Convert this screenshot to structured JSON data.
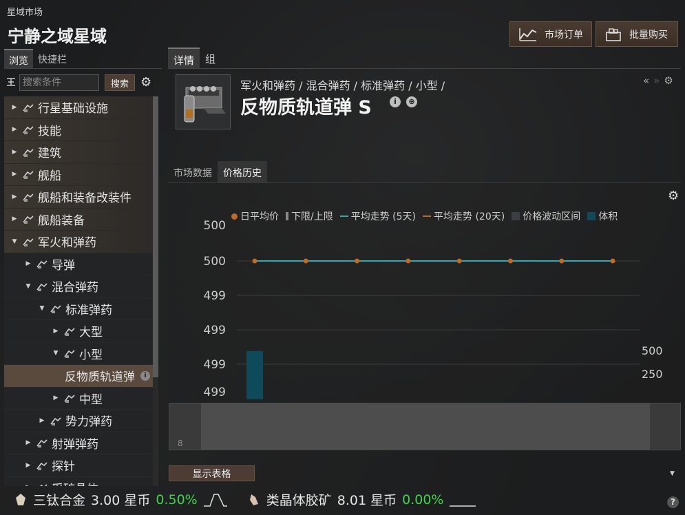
{
  "window": {
    "title": "星域市场",
    "region": "宁静之域星域",
    "buttons": {
      "orders": "市场订单",
      "bulk_buy": "批量购买"
    }
  },
  "left": {
    "tabs": [
      "浏览",
      "快捷栏"
    ],
    "active_tab": "浏览",
    "search": {
      "placeholder": "搜索条件",
      "button": "搜索"
    },
    "tree": [
      {
        "label": "行星基础设施",
        "level": 0,
        "expanded": false,
        "icon": "planet-icon"
      },
      {
        "label": "技能",
        "level": 0,
        "expanded": false,
        "icon": "book-icon"
      },
      {
        "label": "建筑",
        "level": 0,
        "expanded": false,
        "icon": "structure-icon"
      },
      {
        "label": "舰船",
        "level": 0,
        "expanded": false,
        "icon": "ship-icon"
      },
      {
        "label": "舰船和装备改装件",
        "level": 0,
        "expanded": false,
        "icon": "rig-icon"
      },
      {
        "label": "舰船装备",
        "level": 0,
        "expanded": false,
        "icon": "module-icon"
      },
      {
        "label": "军火和弹药",
        "level": 0,
        "expanded": true,
        "icon": "ammo-icon"
      },
      {
        "label": "导弹",
        "level": 1,
        "expanded": false,
        "icon": "missile-icon"
      },
      {
        "label": "混合弹药",
        "level": 1,
        "expanded": true,
        "icon": "hybrid-icon"
      },
      {
        "label": "标准弹药",
        "level": 2,
        "expanded": true,
        "icon": "hybrid-icon"
      },
      {
        "label": "大型",
        "level": 3,
        "expanded": false,
        "icon": "hybrid-icon"
      },
      {
        "label": "小型",
        "level": 3,
        "expanded": true,
        "icon": "hybrid-icon"
      },
      {
        "label": "反物质轨道弹",
        "level": 4,
        "leaf": true,
        "selected": true
      },
      {
        "label": "中型",
        "level": 3,
        "expanded": false,
        "icon": "hybrid-icon"
      },
      {
        "label": "势力弹药",
        "level": 2,
        "expanded": false,
        "icon": "faction-icon"
      },
      {
        "label": "射弹弹药",
        "level": 1,
        "expanded": false,
        "icon": "projectile-icon"
      },
      {
        "label": "探针",
        "level": 1,
        "expanded": false,
        "icon": "probe-icon"
      },
      {
        "label": "采矿晶体",
        "level": 1,
        "expanded": false,
        "icon": "crystal-icon"
      }
    ]
  },
  "right": {
    "tabs": [
      "详情",
      "组"
    ],
    "active_tab": "详情",
    "breadcrumb": "军火和弹药 / 混合弹药 / 标准弹药 / 小型 /",
    "item_name": "反物质轨道弹 S",
    "sub_tabs": [
      "市场数据",
      "价格历史"
    ],
    "active_sub_tab": "价格历史",
    "show_table": "显示表格",
    "slider_label": "8"
  },
  "chart_data": {
    "type": "line",
    "legend": [
      {
        "name": "日平均价",
        "kind": "dot",
        "color": "#c06a22"
      },
      {
        "name": "下限/上限",
        "kind": "bar",
        "color": "#888888"
      },
      {
        "name": "平均走势 (5天)",
        "kind": "line",
        "color": "#3aa6b0"
      },
      {
        "name": "平均走势 (20天)",
        "kind": "line",
        "color": "#c06a22"
      },
      {
        "name": "价格波动区间",
        "kind": "square",
        "color": "#3a3f44"
      },
      {
        "name": "体积",
        "kind": "square",
        "color": "#0f4a5a"
      }
    ],
    "y_tick_labels": [
      "500",
      "500",
      "499",
      "499",
      "499",
      "499"
    ],
    "volume_tick_labels": [
      "500",
      "250"
    ],
    "series": [
      {
        "name": "日平均价",
        "values": [
          500,
          500,
          500,
          500,
          500,
          500,
          500,
          500
        ]
      },
      {
        "name": "平均走势 (5天)",
        "values": [
          500,
          500,
          500,
          500,
          500,
          500,
          500,
          500
        ]
      }
    ],
    "volume": [
      620,
      0,
      0,
      0,
      0,
      0,
      0,
      0
    ],
    "volume_max": 750
  },
  "ticker": [
    {
      "name": "三钛合金",
      "price": "3.00 星币",
      "change": "0.50%",
      "icon": "mineral-icon"
    },
    {
      "name": "类晶体胶矿",
      "price": "8.01 星币",
      "change": "0.00%",
      "icon": "mineral-icon"
    }
  ]
}
